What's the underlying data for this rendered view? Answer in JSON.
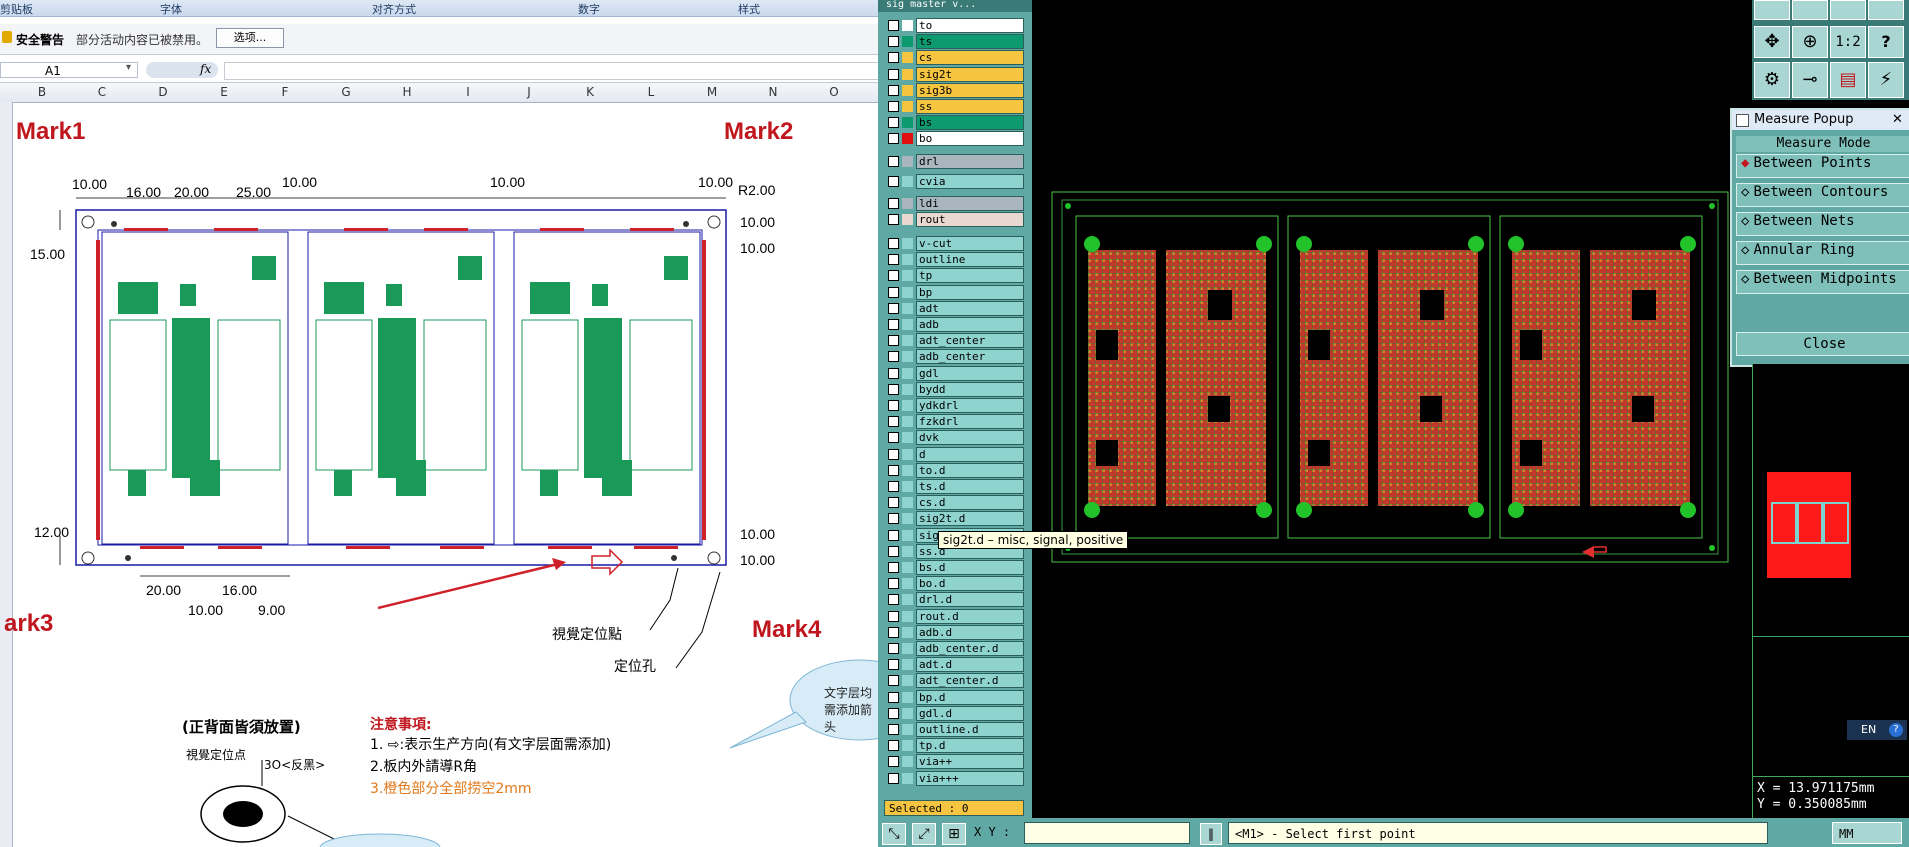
{
  "excel": {
    "ribbon_groups": [
      "剪贴板",
      "字体",
      "对齐方式",
      "数字",
      "样式"
    ],
    "security": {
      "title": "安全警告",
      "message": "部分活动内容已被禁用。",
      "options_button": "选项..."
    },
    "name_box": "A1",
    "fx": "fx",
    "columns": [
      "B",
      "C",
      "D",
      "E",
      "F",
      "G",
      "H",
      "I",
      "J",
      "K",
      "L",
      "M",
      "N",
      "O"
    ],
    "drawing": {
      "marks": [
        "Mark1",
        "Mark2",
        "ark3",
        "Mark4"
      ],
      "dimensions": [
        "10.00",
        "16.00",
        "20.00",
        "25.00",
        "10.00",
        "10.00",
        "10.00",
        "R2.00",
        "10.00",
        "10.00",
        "15.00",
        "12.00",
        "10.00",
        "10.00",
        "20.00",
        "16.00",
        "10.00",
        "9.00"
      ],
      "vision_point_label": "視覺定位點",
      "locating_hole_label": "定位孔",
      "placement_title": "(正背面皆須放置)",
      "vision_point_small": "視覺定位点",
      "size_label": "3O<反黑>",
      "notes_title": "注意事項:",
      "notes": [
        "1. ⇨:表示生产方向(有文字层面需添加)",
        "2.板内外請導R角",
        "3.橙色部分全部捞空2mm"
      ],
      "callout_text": "文字层均需添加箭头"
    }
  },
  "layers": {
    "header": "sig master v...",
    "items": [
      {
        "name": "to",
        "color": "#ffffff",
        "bg": "#ffffff"
      },
      {
        "name": "ts",
        "color": "#0d9a6e",
        "bg": "#0d9a6e"
      },
      {
        "name": "cs",
        "color": "#f5c542",
        "bg": "#f5c542"
      },
      {
        "name": "sig2t",
        "color": "#f5c542",
        "bg": "#f5c542"
      },
      {
        "name": "sig3b",
        "color": "#f5c542",
        "bg": "#f5c542"
      },
      {
        "name": "ss",
        "color": "#f5c542",
        "bg": "#f5c542"
      },
      {
        "name": "bs",
        "color": "#0d9a6e",
        "bg": "#0d9a6e"
      },
      {
        "name": "bo",
        "color": "#e01010",
        "bg": "#ffffff"
      },
      {
        "name": "drl",
        "color": "#aab6be",
        "bg": "#aab6be"
      },
      {
        "name": "cvia",
        "color": "#8fd3cf",
        "bg": "#8fd3cf"
      },
      {
        "name": "ldi",
        "color": "#aab6be",
        "bg": "#aab6be"
      },
      {
        "name": "rout",
        "color": "#e8d8d0",
        "bg": "#e8d8d0"
      },
      {
        "name": "v-cut",
        "color": "#8fd3cf",
        "bg": "#8fd3cf"
      },
      {
        "name": "outline",
        "color": "#8fd3cf",
        "bg": "#8fd3cf"
      },
      {
        "name": "tp",
        "color": "#8fd3cf",
        "bg": "#8fd3cf"
      },
      {
        "name": "bp",
        "color": "#8fd3cf",
        "bg": "#8fd3cf"
      },
      {
        "name": "adt",
        "color": "#8fd3cf",
        "bg": "#8fd3cf"
      },
      {
        "name": "adb",
        "color": "#8fd3cf",
        "bg": "#8fd3cf"
      },
      {
        "name": "adt_center",
        "color": "#8fd3cf",
        "bg": "#8fd3cf"
      },
      {
        "name": "adb_center",
        "color": "#8fd3cf",
        "bg": "#8fd3cf"
      },
      {
        "name": "gdl",
        "color": "#8fd3cf",
        "bg": "#8fd3cf"
      },
      {
        "name": "bydd",
        "color": "#8fd3cf",
        "bg": "#8fd3cf"
      },
      {
        "name": "ydkdrl",
        "color": "#8fd3cf",
        "bg": "#8fd3cf"
      },
      {
        "name": "fzkdrl",
        "color": "#8fd3cf",
        "bg": "#8fd3cf"
      },
      {
        "name": "dvk",
        "color": "#8fd3cf",
        "bg": "#8fd3cf"
      },
      {
        "name": "d",
        "color": "#8fd3cf",
        "bg": "#8fd3cf"
      },
      {
        "name": "to.d",
        "color": "#8fd3cf",
        "bg": "#8fd3cf"
      },
      {
        "name": "ts.d",
        "color": "#8fd3cf",
        "bg": "#8fd3cf"
      },
      {
        "name": "cs.d",
        "color": "#8fd3cf",
        "bg": "#8fd3cf"
      },
      {
        "name": "sig2t.d",
        "color": "#8fd3cf",
        "bg": "#8fd3cf"
      },
      {
        "name": "sig3b.d",
        "color": "#8fd3cf",
        "bg": "#8fd3cf"
      },
      {
        "name": "ss.d",
        "color": "#8fd3cf",
        "bg": "#8fd3cf"
      },
      {
        "name": "bs.d",
        "color": "#8fd3cf",
        "bg": "#8fd3cf"
      },
      {
        "name": "bo.d",
        "color": "#8fd3cf",
        "bg": "#8fd3cf"
      },
      {
        "name": "drl.d",
        "color": "#8fd3cf",
        "bg": "#8fd3cf"
      },
      {
        "name": "rout.d",
        "color": "#8fd3cf",
        "bg": "#8fd3cf"
      },
      {
        "name": "adb.d",
        "color": "#8fd3cf",
        "bg": "#8fd3cf"
      },
      {
        "name": "adb_center.d",
        "color": "#8fd3cf",
        "bg": "#8fd3cf"
      },
      {
        "name": "adt.d",
        "color": "#8fd3cf",
        "bg": "#8fd3cf"
      },
      {
        "name": "adt_center.d",
        "color": "#8fd3cf",
        "bg": "#8fd3cf"
      },
      {
        "name": "bp.d",
        "color": "#8fd3cf",
        "bg": "#8fd3cf"
      },
      {
        "name": "gdl.d",
        "color": "#8fd3cf",
        "bg": "#8fd3cf"
      },
      {
        "name": "outline.d",
        "color": "#8fd3cf",
        "bg": "#8fd3cf"
      },
      {
        "name": "tp.d",
        "color": "#8fd3cf",
        "bg": "#8fd3cf"
      },
      {
        "name": "via++",
        "color": "#8fd3cf",
        "bg": "#8fd3cf"
      },
      {
        "name": "via+++",
        "color": "#8fd3cf",
        "bg": "#8fd3cf"
      }
    ],
    "tooltip": "sig2t.d – misc, signal, positive",
    "selected": "Selected : 0"
  },
  "measure": {
    "title": "Measure Popup",
    "mode_label": "Measure Mode",
    "options": [
      "Between Points",
      "Between Contours",
      "Between Nets",
      "Annular Ring",
      "Between Midpoints"
    ],
    "selected_option": "Between Points",
    "close": "Close"
  },
  "coords": {
    "x": "X = 13.971175mm",
    "y": "Y = 0.350085mm"
  },
  "statusbar": {
    "xy_label": "X Y :",
    "xy_value": "",
    "prompt": "<M1> - Select first point",
    "units": "MM",
    "lang": "EN"
  },
  "zoom_buttons": [
    "1:2"
  ]
}
